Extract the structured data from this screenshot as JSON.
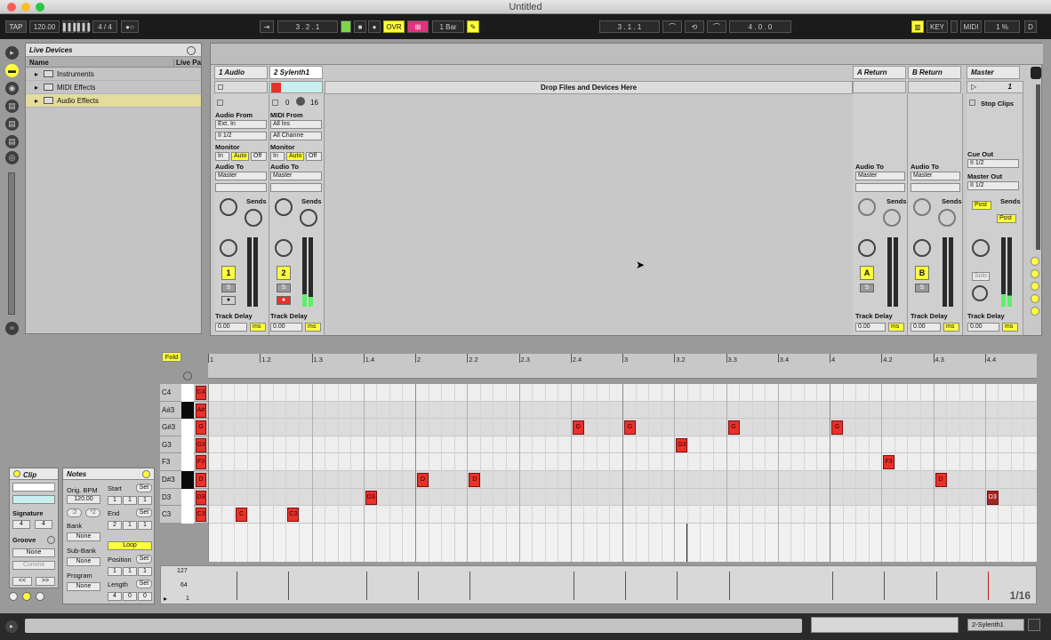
{
  "window": {
    "title": "Untitled"
  },
  "transport": {
    "tap": "TAP",
    "tempo": "120.00",
    "metronome_bars": "▌▌▌",
    "sync_bars": "▌▌▌",
    "signature": "4 / 4",
    "metro_dots": "●○",
    "arrangement_pos": "3 .   2 .   1",
    "overdub": "OVR",
    "quantize": "1 Bar",
    "loop_start": "3 .   1 .   1",
    "loop_length": "4 .   0 .   0",
    "key": "KEY",
    "midi": "MIDI",
    "cpu": "1 %",
    "disk": "D"
  },
  "browser": {
    "title": "Live Devices",
    "column_name": "Name",
    "column_live": "Live Pa",
    "items": [
      {
        "label": "Instruments"
      },
      {
        "label": "MIDI Effects"
      },
      {
        "label": "Audio Effects"
      }
    ]
  },
  "session": {
    "drop_text": "Drop Files and Devices Here",
    "tracks": [
      {
        "name": "1 Audio",
        "input_label": "Audio From",
        "input": "Ext. In",
        "channel": "II 1/2",
        "monitor_label": "Monitor",
        "monitor": [
          "In",
          "Auto",
          "Off"
        ],
        "output_label": "Audio To",
        "output": "Master",
        "sends_label": "Sends",
        "number": "1",
        "solo": "S",
        "arm": "●",
        "delay_label": "Track Delay",
        "delay": "0.00",
        "unit": "ms"
      },
      {
        "name": "2 Sylenth1",
        "input_label": "MIDI From",
        "input": "All Ins",
        "channel": "All Channe",
        "monitor_label": "Monitor",
        "monitor": [
          "In",
          "Auto",
          "Off"
        ],
        "output_label": "Audio To",
        "output": "Master",
        "sends_label": "Sends",
        "number": "2",
        "solo": "S",
        "arm": "●",
        "delay_label": "Track Delay",
        "delay": "0.00",
        "unit": "ms",
        "io_values": [
          "0",
          "16"
        ]
      }
    ],
    "returns": [
      {
        "name": "A Return",
        "output_label": "Audio To",
        "output": "Master",
        "sends_label": "Sends",
        "letter": "A",
        "solo": "S",
        "delay_label": "Track Delay",
        "delay": "0.00",
        "unit": "ms"
      },
      {
        "name": "B Return",
        "output_label": "Audio To",
        "output": "Master",
        "sends_label": "Sends",
        "letter": "B",
        "solo": "S",
        "delay_label": "Track Delay",
        "delay": "0.00",
        "unit": "ms"
      }
    ],
    "master": {
      "name": "Master",
      "scene": "1",
      "stop_clips": "Stop Clips",
      "cue_label": "Cue Out",
      "cue": "II 1/2",
      "out_label": "Master Out",
      "out": "II 1/2",
      "sends_label": "Sends",
      "post1": "Post",
      "post2": "Post",
      "solo": "Solo",
      "delay_label": "Track Delay",
      "delay": "0.00",
      "unit": "ms"
    }
  },
  "clip": {
    "title": "Clip",
    "signature_label": "Signature",
    "sig_num": "4",
    "sig_den": "4",
    "groove_label": "Groove",
    "groove": "None",
    "commit": "Commit",
    "nav_left": "<<",
    "nav_right": ">>"
  },
  "notes": {
    "title": "Notes",
    "orig_bpm_label": "Orig. BPM",
    "orig_bpm": "120.00",
    "half": ":2",
    "double": "*2",
    "bank_label": "Bank",
    "bank": "None",
    "subbank_label": "Sub-Bank",
    "subbank": "None",
    "program_label": "Program",
    "program": "None",
    "start_label": "Start",
    "start": [
      "1",
      "1",
      "1"
    ],
    "end_label": "End",
    "end": [
      "2",
      "1",
      "1"
    ],
    "loop": "Loop",
    "position_label": "Position",
    "position": [
      "1",
      "1",
      "1"
    ],
    "length_label": "Length",
    "length": [
      "4",
      "0",
      "0"
    ],
    "set": "Set"
  },
  "editor": {
    "fold": "Fold",
    "ruler": [
      "1",
      "1.2",
      "1.3",
      "1.4",
      "2",
      "2.2",
      "2.3",
      "2.4",
      "3",
      "3.2",
      "3.3",
      "3.4",
      "4",
      "4.2",
      "4.3",
      "4.4"
    ],
    "key_labels": [
      "C4",
      "A#3",
      "G#3",
      "G3",
      "F3",
      "D#3",
      "D3",
      "C3"
    ],
    "piano_notes": [
      "C4",
      "A#",
      "G",
      "G3",
      "F3",
      "D",
      "D3",
      "C3"
    ],
    "notes": [
      {
        "label": "C",
        "row": 7,
        "col": 1
      },
      {
        "label": "C3",
        "row": 7,
        "col": 3
      },
      {
        "label": "D3",
        "row": 6,
        "col": 6
      },
      {
        "label": "D",
        "row": 5,
        "col": 8
      },
      {
        "label": "D",
        "row": 5,
        "col": 10
      },
      {
        "label": "G",
        "row": 2,
        "col": 14
      },
      {
        "label": "G",
        "row": 2,
        "col": 16
      },
      {
        "label": "G3",
        "row": 3,
        "col": 18
      },
      {
        "label": "G",
        "row": 2,
        "col": 20
      },
      {
        "label": "G",
        "row": 2,
        "col": 24
      },
      {
        "label": "F3",
        "row": 4,
        "col": 26
      },
      {
        "label": "D",
        "row": 5,
        "col": 28
      },
      {
        "label": "D3",
        "row": 6,
        "col": 30,
        "selected": true
      }
    ],
    "grid": "1/16",
    "velocity_labels": [
      "127",
      "64",
      "1"
    ]
  },
  "status": {
    "track": "2-Sylenth1"
  }
}
